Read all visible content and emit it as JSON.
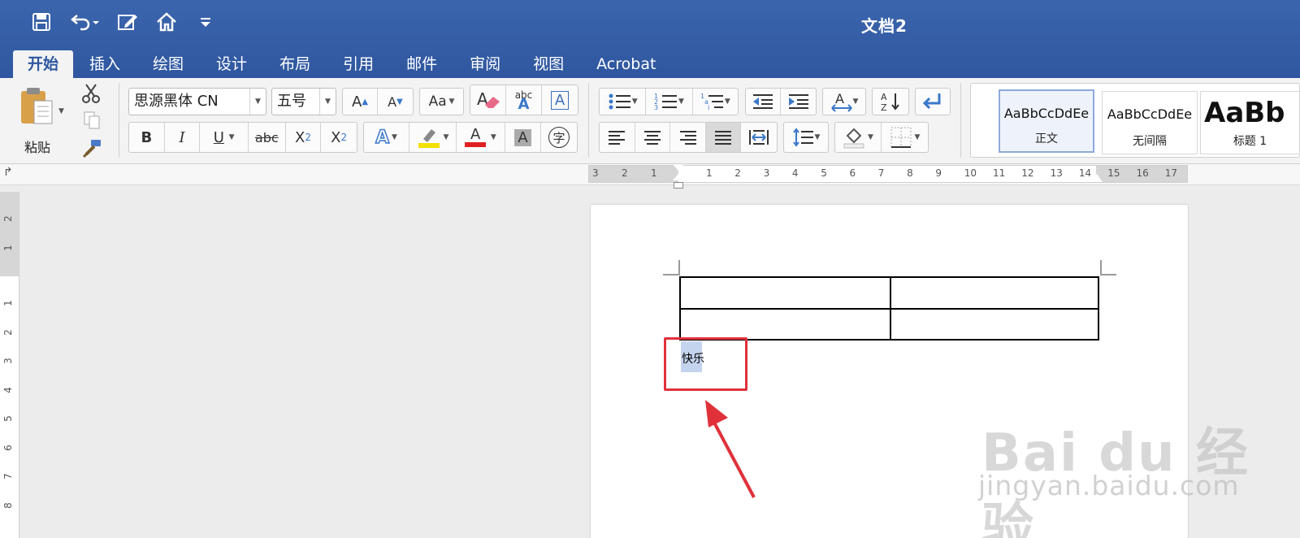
{
  "window": {
    "title": "文档2"
  },
  "tabs": [
    "开始",
    "插入",
    "绘图",
    "设计",
    "布局",
    "引用",
    "邮件",
    "审阅",
    "视图",
    "Acrobat"
  ],
  "clipboard": {
    "paste_label": "粘贴"
  },
  "font": {
    "name": "思源黑体 CN",
    "size": "五号"
  },
  "font_buttons": {
    "grow": "A",
    "shrink": "A",
    "case": "Aa",
    "abc": "abc",
    "text_box": "A",
    "bold": "B",
    "italic": "I",
    "underline": "U",
    "strike": "abc",
    "sub": "X",
    "sub_mark": "2",
    "sup": "X",
    "sup_mark": "2",
    "effects": "A",
    "font_color": "A",
    "shade": "A",
    "phonetic": "字"
  },
  "styles": [
    {
      "sample": "AaBbCcDdEe",
      "label": "正文"
    },
    {
      "sample": "AaBbCcDdEe",
      "label": "无间隔"
    },
    {
      "sample": "AaBb",
      "label": "标题 1"
    }
  ],
  "ruler": {
    "h_numbers": [
      "3",
      "2",
      "1",
      "1",
      "2",
      "3",
      "4",
      "5",
      "6",
      "7",
      "8",
      "9",
      "10",
      "11",
      "12",
      "13",
      "14",
      "15",
      "16",
      "17"
    ],
    "v_numbers": [
      "2",
      "1",
      "1",
      "2",
      "3",
      "4",
      "5",
      "6",
      "7",
      "8"
    ]
  },
  "document": {
    "text": "快乐"
  },
  "watermark": {
    "main": "Bai du 经验",
    "sub": "jingyan.baidu.com"
  },
  "colors": {
    "ribbon_blue": "#2f579f",
    "highlight_yellow": "#f4e000",
    "font_red": "#e02020",
    "annotation_red": "#e0313b"
  }
}
